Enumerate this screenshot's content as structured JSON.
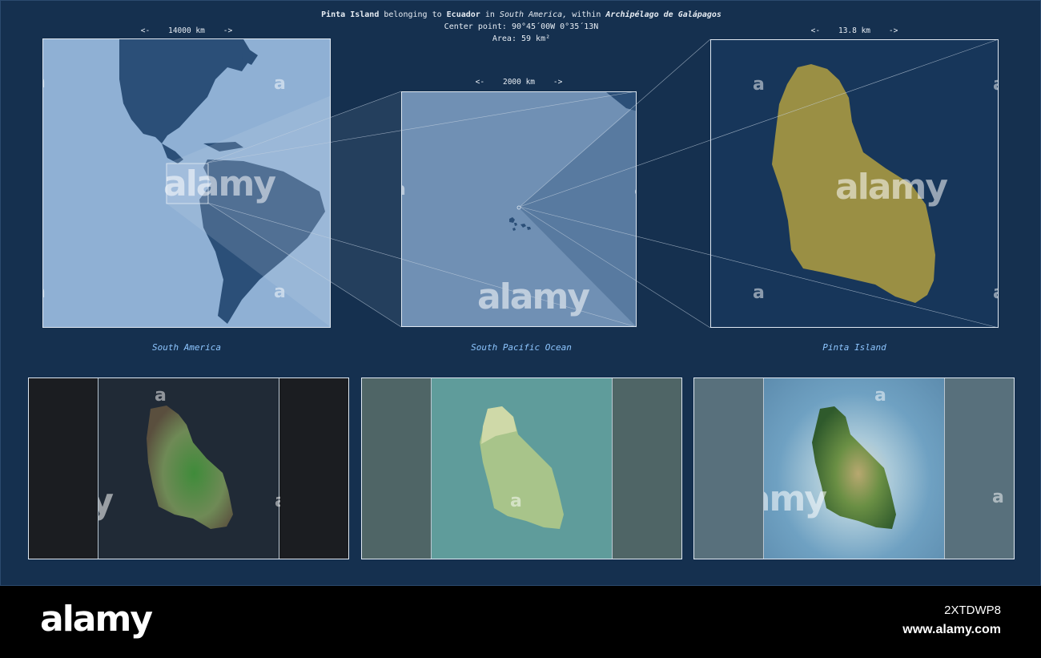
{
  "header": {
    "place": "Pinta Island",
    "belonging": "belonging to",
    "country": "Ecuador",
    "in": "in",
    "continent": "South America,",
    "within": "within",
    "region": "Archipélago de Galápagos",
    "center_point": "Center point: 90°45´00W  0°35´13N",
    "area": "Area: 59 km²"
  },
  "panels": [
    {
      "scale": "<-    14000 km    ->",
      "label": "South America"
    },
    {
      "scale": "<-    2000 km    ->",
      "label": "South Pacific Ocean"
    },
    {
      "scale": "<-    13.8 km    ->",
      "label": "Pinta Island"
    }
  ],
  "watermark": {
    "text": "alamy",
    "letter": "a"
  },
  "footer": {
    "brand": "alamy",
    "image_id": "2XTDWP8",
    "site": "www.alamy.com"
  },
  "colors": {
    "background": "#15304f",
    "land_dark": "#2b4f78",
    "island_highlight": "#9a8f44",
    "label": "#8ec6ff"
  }
}
